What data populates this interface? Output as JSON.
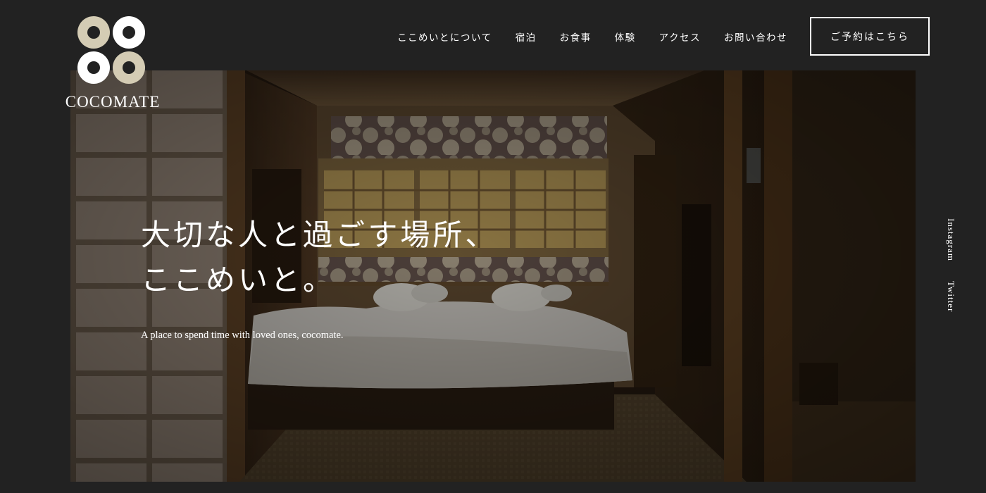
{
  "header": {
    "logo_text": "COCOMATE",
    "nav": [
      {
        "label": "ここめいとについて"
      },
      {
        "label": "宿泊"
      },
      {
        "label": "お食事"
      },
      {
        "label": "体験"
      },
      {
        "label": "アクセス"
      },
      {
        "label": "お問い合わせ"
      }
    ],
    "reserve_label": "ご予約はこちら"
  },
  "hero": {
    "catch_line_1": "大切な人と過ごす場所、",
    "catch_line_2": "ここめいと。",
    "subtitle": "A place to spend time with loved ones, cocomate.",
    "image_subject": "dimly lit Japanese guest room with twin bed, shoji screens and wooden walls"
  },
  "social": [
    {
      "label": "Instagram"
    },
    {
      "label": "Twitter"
    }
  ],
  "colors": {
    "background": "#222222",
    "logo_beige": "#d4ccb4",
    "logo_white": "#ffffff",
    "text": "#ffffff"
  }
}
